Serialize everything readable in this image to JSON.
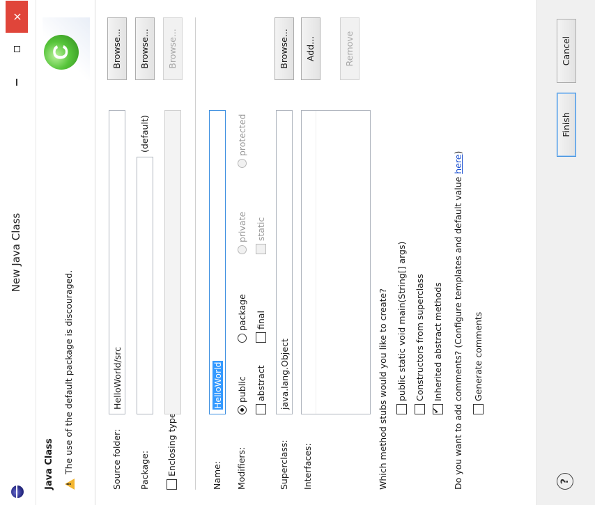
{
  "window": {
    "title": "New Java Class",
    "close_glyph": "×"
  },
  "banner": {
    "title": "Java Class",
    "message": "The use of the default package is discouraged.",
    "warning_icon": "warning-icon",
    "logo_letter": "C"
  },
  "form": {
    "source_folder": {
      "label": "Source folder:",
      "value": "HelloWorld/src",
      "button": "Browse..."
    },
    "package": {
      "label": "Package:",
      "value": "",
      "hint": "(default)",
      "button": "Browse..."
    },
    "enclosing_type": {
      "label": "Enclosing type:",
      "value": "",
      "button": "Browse...",
      "checked": false
    },
    "name": {
      "label": "Name:",
      "value": "HelloWorld"
    },
    "modifiers": {
      "label": "Modifiers:",
      "visibility": [
        {
          "label": "public",
          "selected": true,
          "enabled": true
        },
        {
          "label": "package",
          "selected": false,
          "enabled": true
        },
        {
          "label": "private",
          "selected": false,
          "enabled": false
        },
        {
          "label": "protected",
          "selected": false,
          "enabled": false
        }
      ],
      "flags": [
        {
          "label": "abstract",
          "checked": false,
          "enabled": true
        },
        {
          "label": "final",
          "checked": false,
          "enabled": true
        },
        {
          "label": "static",
          "checked": false,
          "enabled": false
        }
      ]
    },
    "superclass": {
      "label": "Superclass:",
      "value": "java.lang.Object",
      "button": "Browse..."
    },
    "interfaces": {
      "label": "Interfaces:",
      "add_button": "Add...",
      "remove_button": "Remove",
      "items": []
    },
    "stubs": {
      "question": "Which method stubs would you like to create?",
      "options": [
        {
          "label": "public static void main(String[] args)",
          "checked": false
        },
        {
          "label": "Constructors from superclass",
          "checked": false
        },
        {
          "label": "Inherited abstract methods",
          "checked": true
        }
      ]
    },
    "comments": {
      "question": "Do you want to add comments? (Configure templates and default value ",
      "link": "here",
      "question_end": ")",
      "option": {
        "label": "Generate comments",
        "checked": false
      }
    }
  },
  "footer": {
    "help_glyph": "?",
    "finish": "Finish",
    "cancel": "Cancel"
  },
  "colors": {
    "close": "#e0453a",
    "focus": "#3c8fe0",
    "selection": "#3399ff",
    "link": "#1a4fd0"
  }
}
